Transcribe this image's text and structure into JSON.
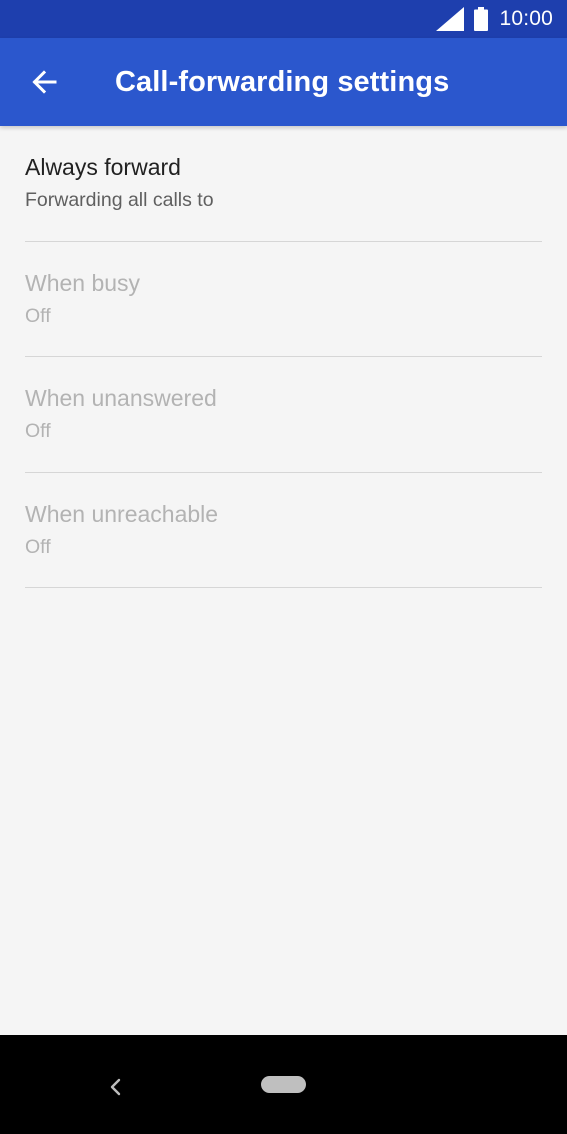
{
  "status_bar": {
    "time": "10:00",
    "icons": [
      "cell-signal-icon",
      "battery-icon"
    ]
  },
  "app_bar": {
    "back_icon": "arrow-left-icon",
    "title": "Call-forwarding settings",
    "background": "#2b57cd",
    "status_background": "#1e3fae"
  },
  "settings": {
    "items": [
      {
        "title": "Always forward",
        "subtitle": "Forwarding all calls to",
        "enabled": true
      },
      {
        "title": "When busy",
        "subtitle": "Off",
        "enabled": false
      },
      {
        "title": "When unanswered",
        "subtitle": "Off",
        "enabled": false
      },
      {
        "title": "When unreachable",
        "subtitle": "Off",
        "enabled": false
      }
    ]
  },
  "nav_bar": {
    "icons": [
      "nav-back-icon",
      "nav-home-pill-icon"
    ]
  }
}
